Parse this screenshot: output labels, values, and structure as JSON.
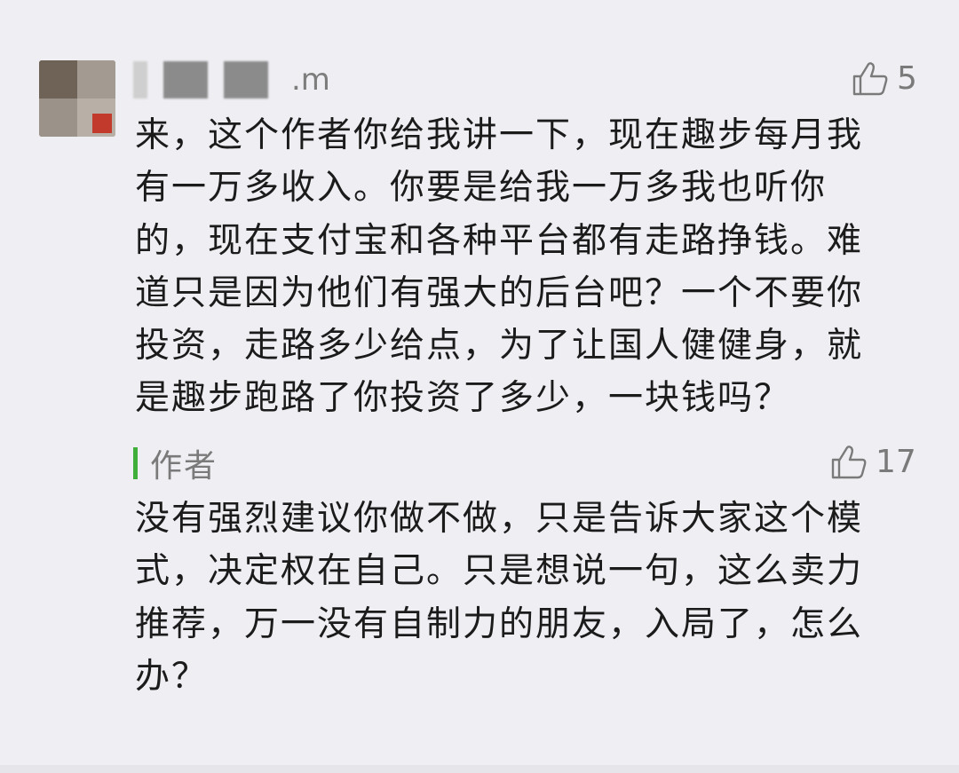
{
  "comment": {
    "username_suffix": ".m",
    "like_count": "5",
    "text": "来，这个作者你给我讲一下，现在趣步每月我\n有一万多收入。你要是给我一万多我也听你\n的，现在支付宝和各种平台都有走路挣钱。难\n道只是因为他们有强大的后台吧？一个不要你\n投资，走路多少给点，为了让国人健健身，就\n是趣步跑路了你投资了多少，一块钱吗？"
  },
  "reply": {
    "author_label": "作者",
    "like_count": "17",
    "text": "没有强烈建议你做不做，只是告诉大家这个模\n式，决定权在自己。只是想说一句，这么卖力\n推荐，万一没有自制力的朋友，入局了，怎么\n办？"
  },
  "icons": {
    "like": "thumbs-up-icon"
  },
  "colors": {
    "background": "#efeef3",
    "author_bar": "#3fae3a",
    "meta_text": "#7a7a7a"
  }
}
